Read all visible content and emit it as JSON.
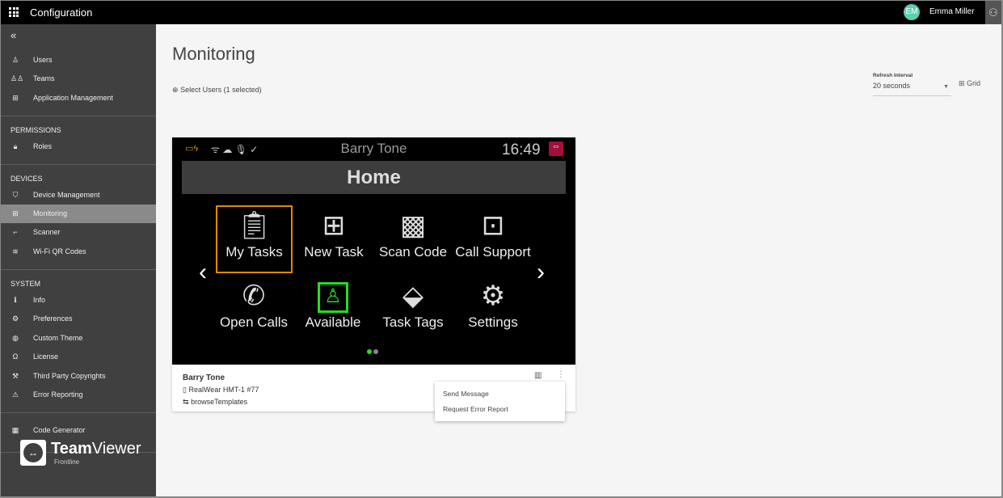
{
  "topbar": {
    "title": "Configuration",
    "user_initials": "EM",
    "user_name": "Emma Miller",
    "avatar_color": "#5ccfb0"
  },
  "sidebar": {
    "items": [
      {
        "label": "Users",
        "icon": "user-icon"
      },
      {
        "label": "Teams",
        "icon": "team-icon"
      },
      {
        "label": "Application Management",
        "icon": "apps-icon"
      }
    ],
    "permissions_title": "PERMISSIONS",
    "permissions": [
      {
        "label": "Roles",
        "icon": "lock-icon"
      }
    ],
    "devices_title": "DEVICES",
    "devices": [
      {
        "label": "Device Management",
        "icon": "shield-icon"
      },
      {
        "label": "Monitoring",
        "icon": "grid-icon",
        "active": true
      },
      {
        "label": "Scanner",
        "icon": "scanner-icon"
      },
      {
        "label": "Wi-Fi QR Codes",
        "icon": "wifi-icon"
      }
    ],
    "system_title": "SYSTEM",
    "system": [
      {
        "label": "Info",
        "icon": "info-icon"
      },
      {
        "label": "Preferences",
        "icon": "gear-icon"
      },
      {
        "label": "Custom Theme",
        "icon": "palette-icon"
      },
      {
        "label": "License",
        "icon": "license-icon"
      },
      {
        "label": "Third Party Copyrights",
        "icon": "gavel-icon"
      },
      {
        "label": "Error Reporting",
        "icon": "warning-icon"
      }
    ],
    "extra": [
      {
        "label": "Code Generator",
        "icon": "qr-icon"
      }
    ],
    "logo": {
      "brand_bold": "Team",
      "brand_light": "Viewer",
      "sub": "Frontline"
    }
  },
  "main": {
    "title": "Monitoring",
    "select_users": "Select Users (1 selected)",
    "refresh_label": "Refresh Interval",
    "refresh_value": "20 seconds",
    "view_mode": "Grid"
  },
  "device": {
    "screen": {
      "user": "Barry Tone",
      "time": "16:49",
      "page_title": "Home",
      "tiles": [
        {
          "label": "My Tasks",
          "icon": "clipboard-icon",
          "selected": true
        },
        {
          "label": "New Task",
          "icon": "clipboard-plus-icon"
        },
        {
          "label": "Scan Code",
          "icon": "qr-scan-icon"
        },
        {
          "label": "Call Support",
          "icon": "contact-icon"
        },
        {
          "label": "Open Calls",
          "icon": "phone-icon"
        },
        {
          "label": "Available",
          "icon": "available-icon",
          "status_color": "#22dd22"
        },
        {
          "label": "Task Tags",
          "icon": "tag-icon"
        },
        {
          "label": "Settings",
          "icon": "gear-icon"
        }
      ],
      "page_count": 2,
      "current_page": 1
    },
    "name": "Barry Tone",
    "model": "RealWear HMT-1 #77",
    "activity": "browseTemplates",
    "menu": [
      "Send Message",
      "Request Error Report"
    ]
  }
}
